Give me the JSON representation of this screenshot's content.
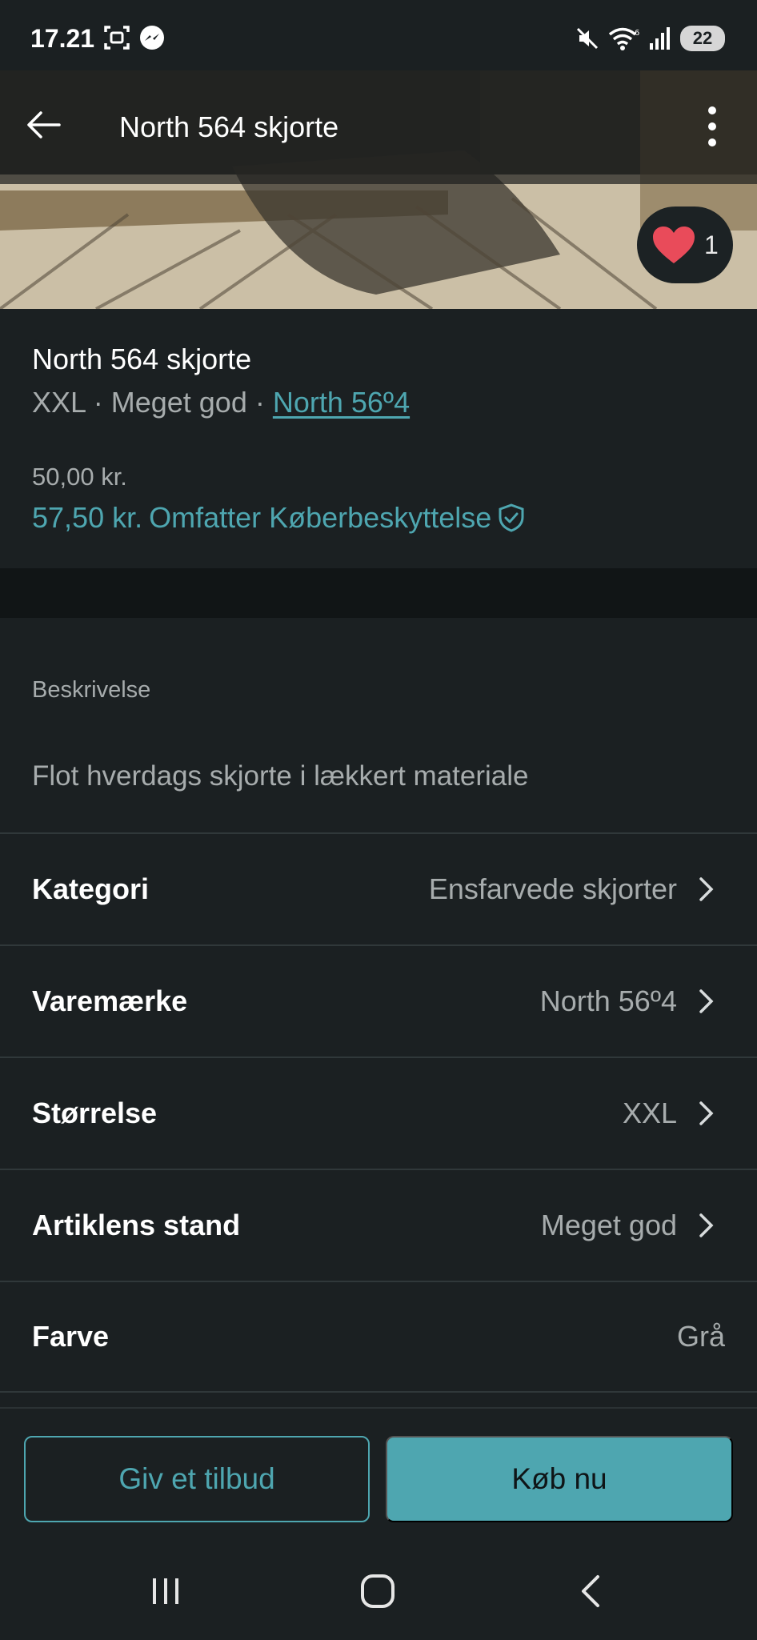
{
  "status_bar": {
    "time": "17.21",
    "battery": "22",
    "icons": [
      "screenshot-icon",
      "messenger-icon",
      "mute-icon",
      "wifi-icon",
      "signal-icon",
      "battery-icon"
    ]
  },
  "app_bar": {
    "title": "North 564 skjorte"
  },
  "gallery": {
    "image_count": 3,
    "active_index": 0,
    "favorite_count": "1"
  },
  "item": {
    "title": "North 564 skjorte",
    "size": "XXL",
    "condition": "Meget god",
    "separator": " · ",
    "brand": "North 56º4",
    "price": "50,00 kr.",
    "total_price": "57,50 kr.",
    "protection_text": "Omfatter Køberbeskyttelse"
  },
  "description": {
    "label": "Beskrivelse",
    "text": "Flot hverdags skjorte i lækkert materiale"
  },
  "attributes": [
    {
      "label": "Kategori",
      "value": "Ensfarvede skjorter"
    },
    {
      "label": "Varemærke",
      "value": "North 56º4"
    },
    {
      "label": "Størrelse",
      "value": "XXL"
    },
    {
      "label": "Artiklens stand",
      "value": "Meget god"
    },
    {
      "label": "Farve",
      "value": "Grå"
    }
  ],
  "actions": {
    "offer_label": "Giv et tilbud",
    "buy_label": "Køb nu"
  },
  "colors": {
    "background": "#1b2022",
    "accent": "#4ea6b0",
    "heart": "#e94b5a",
    "muted_text": "#a7acad"
  }
}
